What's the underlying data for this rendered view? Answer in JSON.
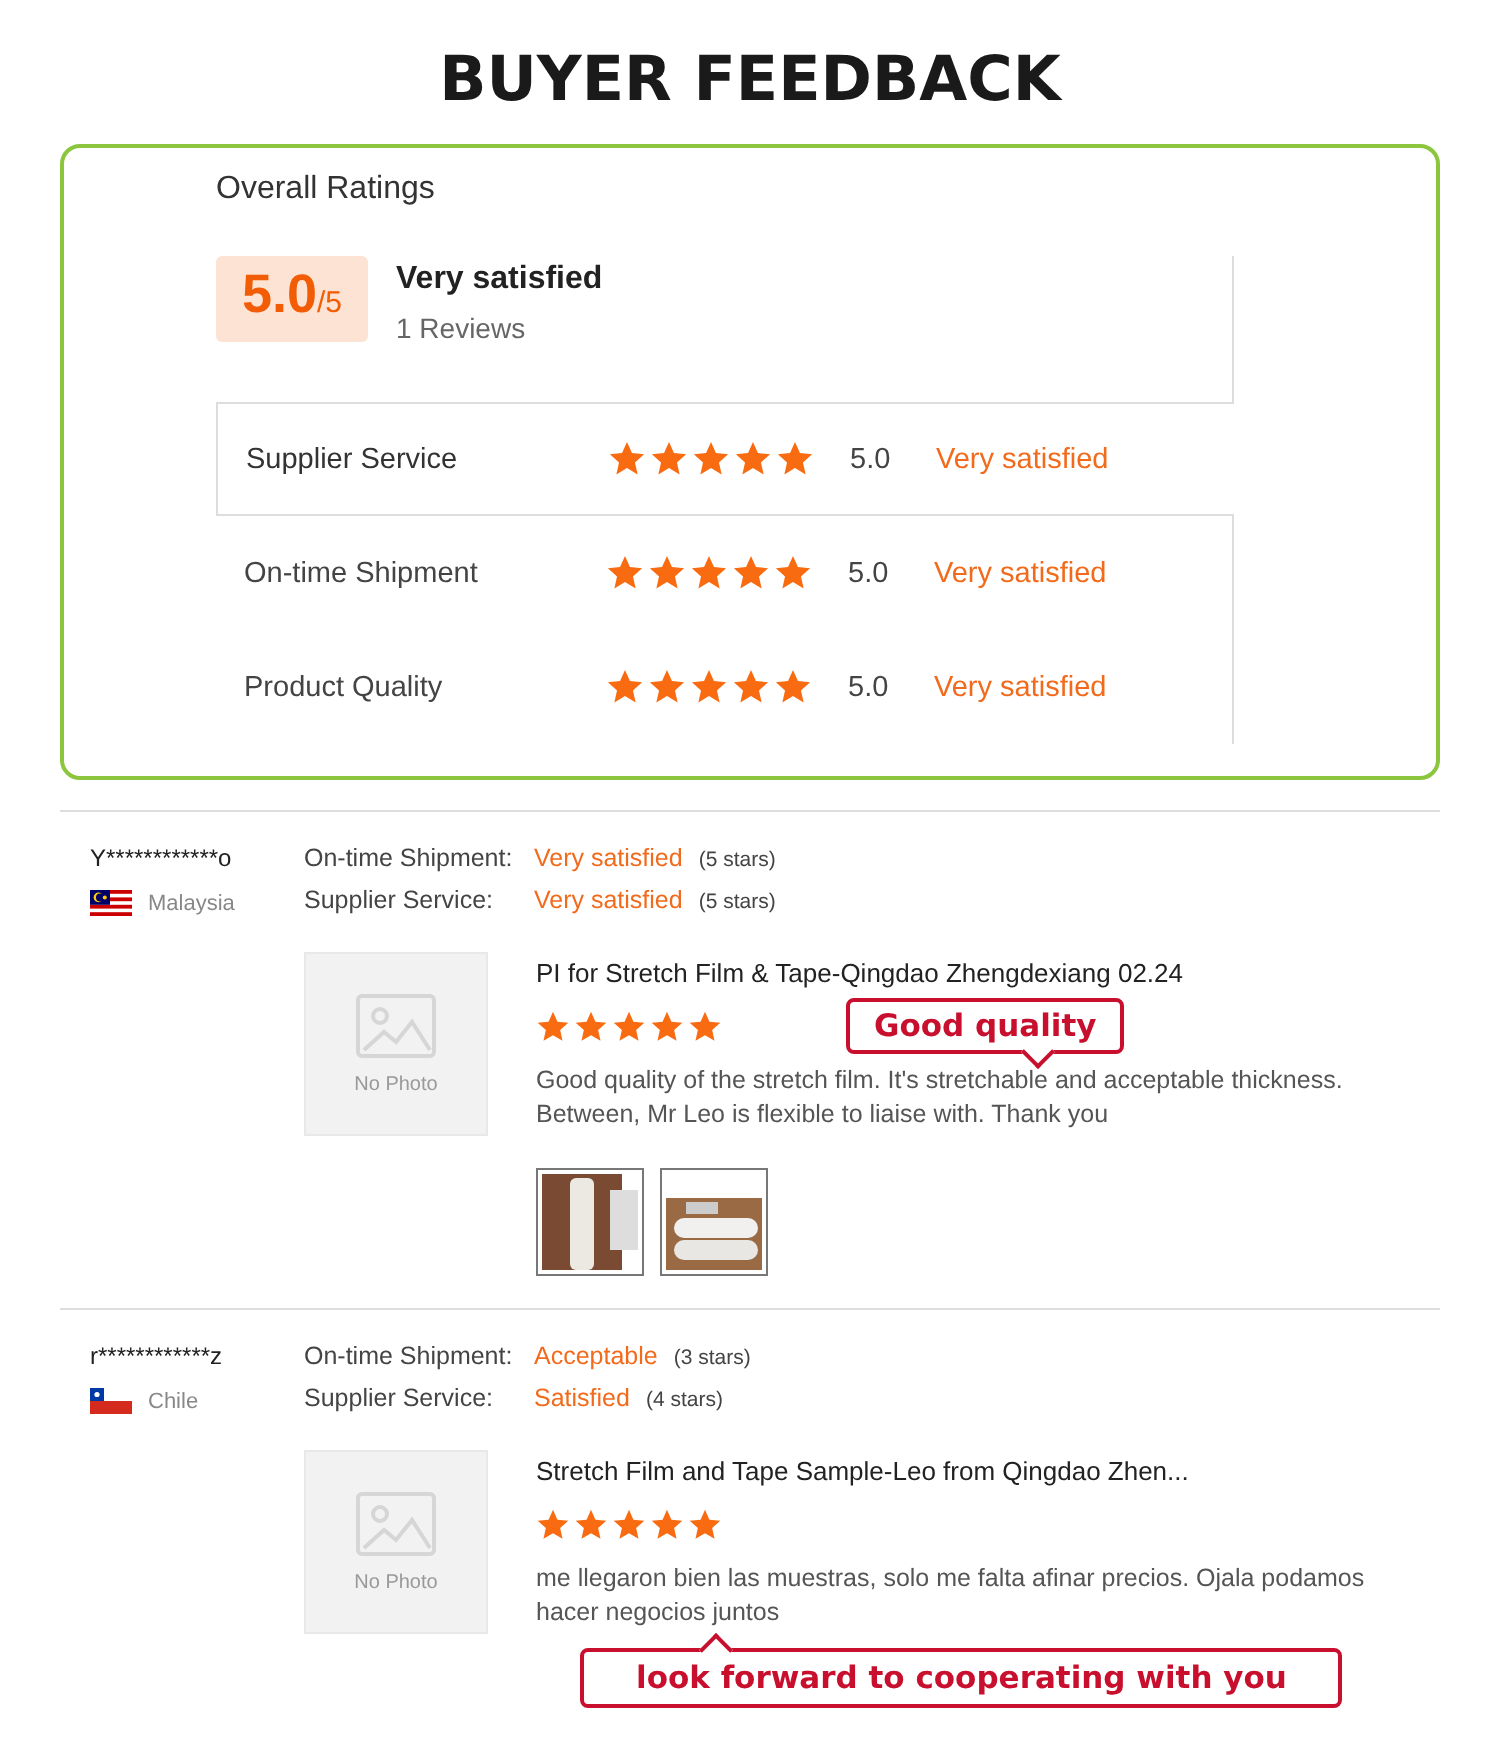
{
  "title": "BUYER FEEDBACK",
  "overall": {
    "heading": "Overall Ratings",
    "score": "5.0",
    "out_of": "/5",
    "verdict": "Very satisfied",
    "reviews": "1 Reviews",
    "categories": [
      {
        "label": "Supplier Service",
        "stars": 5,
        "score": "5.0",
        "verdict": "Very satisfied",
        "selected": true
      },
      {
        "label": "On-time Shipment",
        "stars": 5,
        "score": "5.0",
        "verdict": "Very satisfied",
        "selected": false
      },
      {
        "label": "Product Quality",
        "stars": 5,
        "score": "5.0",
        "verdict": "Very satisfied",
        "selected": false
      }
    ]
  },
  "reviews": [
    {
      "user": "Y************o",
      "flag": {
        "kind": "malaysia"
      },
      "country": "Malaysia",
      "ratings": [
        {
          "label": "On-time Shipment:",
          "verdict": "Very satisfied",
          "stars_text": "(5 stars)"
        },
        {
          "label": "Supplier Service:",
          "verdict": "Very satisfied",
          "stars_text": "(5 stars)"
        }
      ],
      "photo_label": "No Photo",
      "product": "PI for Stretch Film & Tape-Qingdao Zhengdexiang 02.24",
      "stars": 5,
      "text": "Good quality of the stretch film. It's stretchable and acceptable thickness.  Between, Mr Leo is flexible to liaise with.  Thank you",
      "thumbnails": [
        {
          "kind": "upright"
        },
        {
          "kind": "lying"
        }
      ],
      "callout": {
        "text": "Good quality",
        "kind": "beside"
      }
    },
    {
      "user": "r************z",
      "flag": {
        "kind": "chile"
      },
      "country": "Chile",
      "ratings": [
        {
          "label": "On-time Shipment:",
          "verdict": "Acceptable",
          "stars_text": "(3 stars)"
        },
        {
          "label": "Supplier Service:",
          "verdict": "Satisfied",
          "stars_text": "(4 stars)"
        }
      ],
      "photo_label": "No Photo",
      "product": "Stretch Film and Tape Sample-Leo from Qingdao Zhen...",
      "stars": 5,
      "text": "me llegaron bien las muestras, solo me falta afinar precios. Ojala podamos hacer negocios juntos",
      "callout": {
        "text": "look forward to cooperating with you",
        "kind": "below"
      }
    }
  ]
}
